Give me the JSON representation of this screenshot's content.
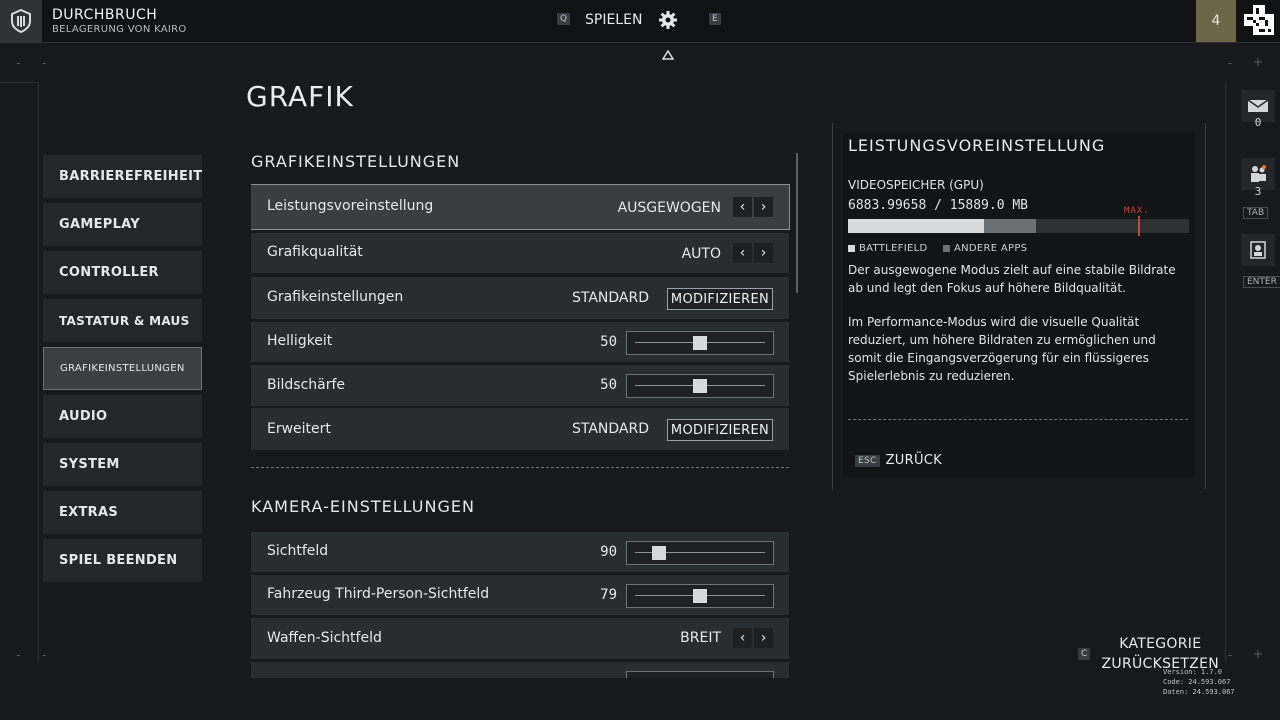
{
  "topbar": {
    "mode_title": "DURCHBRUCH",
    "mode_subtitle": "BELAGERUNG VON KAIRO",
    "key_prev": "Q",
    "play_label": "SPIELEN",
    "key_next": "E",
    "level": "4"
  },
  "page_title": "GRAFIK",
  "sidebar": {
    "items": [
      {
        "label": "BARRIEREFREIHEIT"
      },
      {
        "label": "GAMEPLAY"
      },
      {
        "label": "CONTROLLER"
      },
      {
        "label": "TASTATUR & MAUS"
      },
      {
        "label": "GRAFIKEINSTELLUNGEN",
        "active": true
      },
      {
        "label": "AUDIO"
      },
      {
        "label": "SYSTEM"
      },
      {
        "label": "EXTRAS"
      },
      {
        "label": "SPIEL BEENDEN"
      }
    ]
  },
  "sections": {
    "graphics_title": "GRAFIKEINSTELLUNGEN",
    "camera_title": "KAMERA-EINSTELLUNGEN"
  },
  "graphics_rows": [
    {
      "label": "Leistungsvoreinstellung",
      "value": "AUSGEWOGEN",
      "control": "arrows"
    },
    {
      "label": "Grafikqualität",
      "value": "AUTO",
      "control": "arrows"
    },
    {
      "label": "Grafikeinstellungen",
      "value": "STANDARD",
      "control": "button",
      "button": "MODIFIZIEREN"
    },
    {
      "label": "Helligkeit",
      "value": "50",
      "control": "slider",
      "level": 0.5
    },
    {
      "label": "Bildschärfe",
      "value": "50",
      "control": "slider",
      "level": 0.5
    },
    {
      "label": "Erweitert",
      "value": "STANDARD",
      "control": "button",
      "button": "MODIFIZIEREN"
    }
  ],
  "camera_rows": [
    {
      "label": "Sichtfeld",
      "value": "90",
      "control": "slider",
      "level": 0.15
    },
    {
      "label": "Fahrzeug Third-Person-Sichtfeld",
      "value": "79",
      "control": "slider",
      "level": 0.5
    },
    {
      "label": "Waffen-Sichtfeld",
      "value": "BREIT",
      "control": "arrows"
    }
  ],
  "info": {
    "title": "LEISTUNGSVOREINSTELLUNG",
    "vram_label": "VIDEOSPEICHER (GPU)",
    "vram_values": "6883.99658 / 15889.0 MB",
    "vram_battlefield_fraction": 0.4,
    "vram_other_fraction": 0.15,
    "vram_max_fraction": 0.85,
    "max_label": "MAX.",
    "legend_battlefield": "BATTLEFIELD",
    "legend_other": "ANDERE APPS",
    "desc1": "Der ausgewogene Modus zielt auf eine stabile Bildrate ab und legt den Fokus auf höhere Bildqualität.",
    "desc2": "Im Performance-Modus wird die visuelle Qualität reduziert, um höhere Bildraten zu ermöglichen und somit die Eingangsverzögerung für ein flüssigeres Spielerlebnis zu reduzieren.",
    "back_key": "ESC",
    "back_label": "ZURÜCK"
  },
  "rail": {
    "mail_count": "0",
    "squad_count": "3",
    "tab_key": "TAB",
    "enter_key": "ENTER"
  },
  "reset": {
    "key": "C",
    "line1": "KATEGORIE",
    "line2": "ZURÜCKSETZEN"
  },
  "version": {
    "line1": "Version: 1.7.0",
    "line2": "Code: 24.593.067",
    "line3": "Daten: 24.593.067"
  },
  "colors": {
    "accent_max": "#c8453d",
    "level_badge": "#6b6648"
  }
}
